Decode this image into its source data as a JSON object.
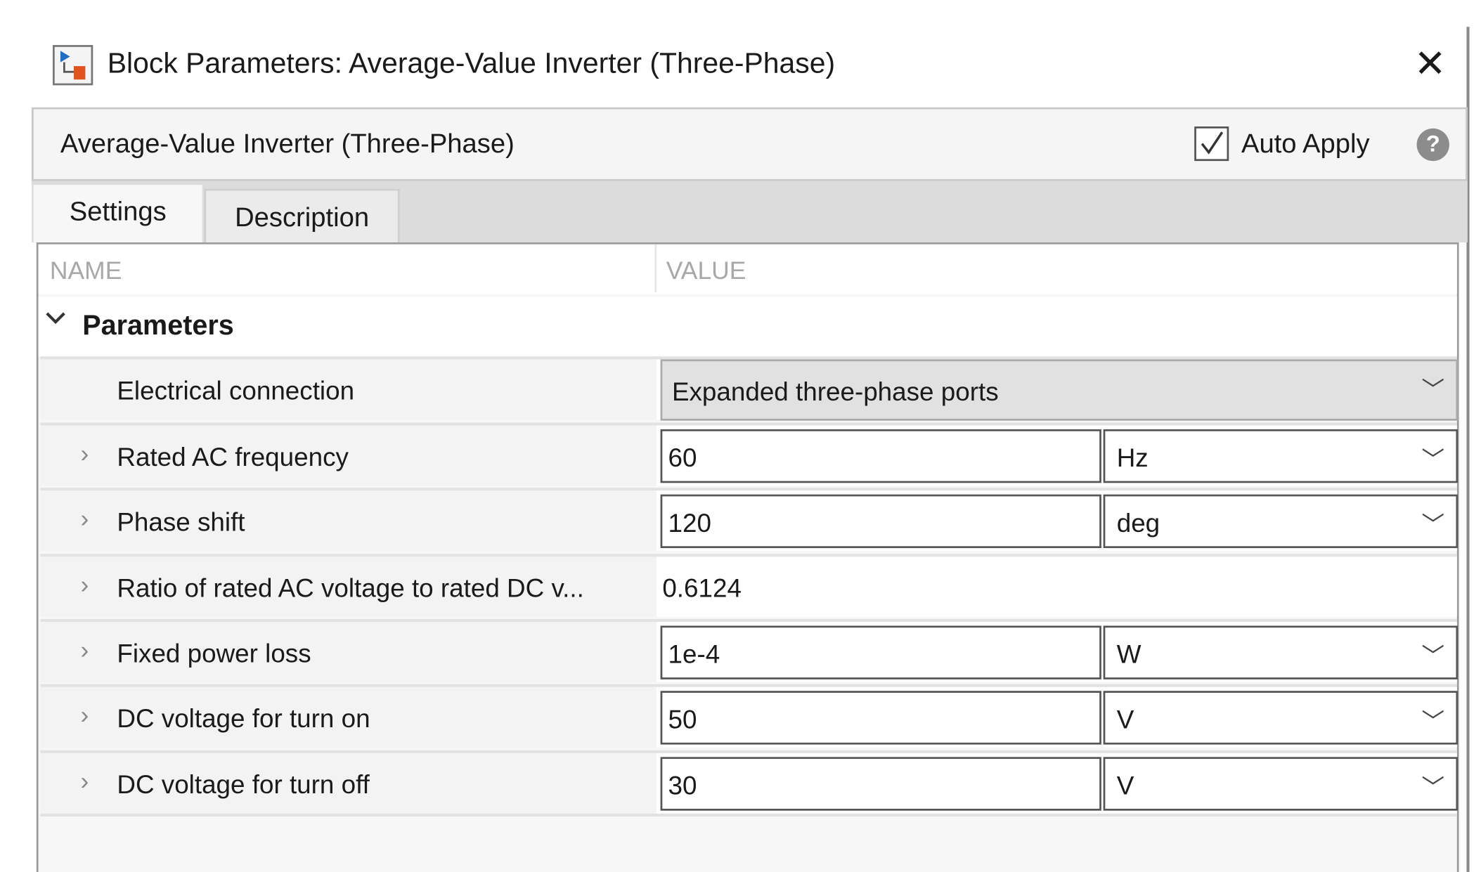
{
  "window": {
    "title": "Block Parameters: Average-Value Inverter (Three-Phase)",
    "close_icon": "close-icon",
    "app_icon": "simulink-block-icon"
  },
  "header": {
    "block_name": "Average-Value Inverter (Three-Phase)",
    "auto_apply_label": "Auto Apply",
    "auto_apply_checked": true,
    "help_icon": "help-icon",
    "help_glyph": "?"
  },
  "tabs": [
    {
      "label": "Settings",
      "active": true
    },
    {
      "label": "Description",
      "active": false
    }
  ],
  "table": {
    "columns": [
      "NAME",
      "VALUE"
    ],
    "group": "Parameters",
    "rows": [
      {
        "name": "Electrical connection",
        "value": "Expanded three-phase ports",
        "type": "dropdown"
      },
      {
        "name": "Rated AC frequency",
        "value": "60",
        "unit": "Hz"
      },
      {
        "name": "Phase shift",
        "value": "120",
        "unit": "deg"
      },
      {
        "name": "Ratio of rated AC voltage to rated DC v...",
        "value": "0.6124",
        "type": "readonly"
      },
      {
        "name": "Fixed power loss",
        "value": "1e-4",
        "unit": "W"
      },
      {
        "name": "DC voltage for turn on",
        "value": "50",
        "unit": "V"
      },
      {
        "name": "DC voltage for turn off",
        "value": "30",
        "unit": "V"
      }
    ]
  }
}
